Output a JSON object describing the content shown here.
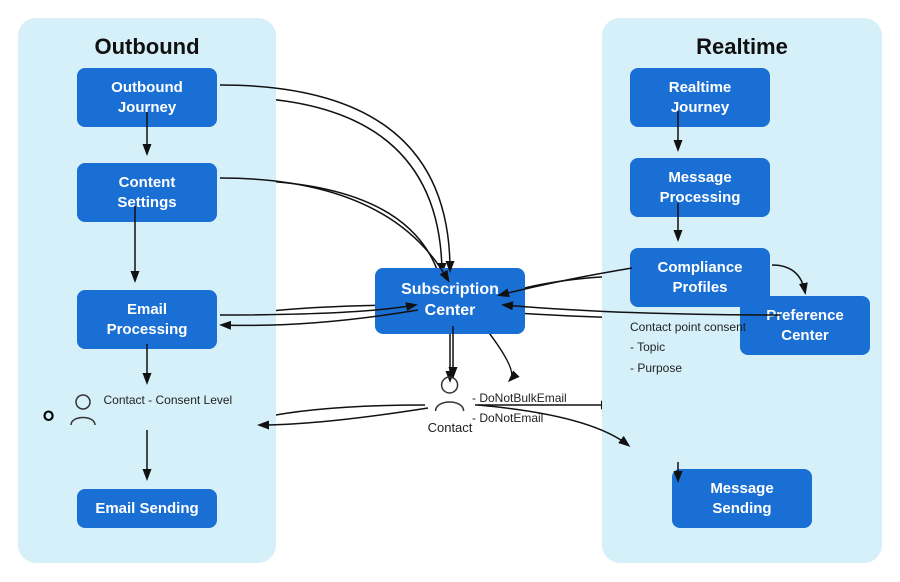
{
  "diagram": {
    "title_outbound": "Outbound",
    "title_realtime": "Realtime",
    "boxes": {
      "outbound_journey": "Outbound Journey",
      "content_settings": "Content Settings",
      "email_processing": "Email Processing",
      "email_sending": "Email Sending",
      "realtime_journey": "Realtime Journey",
      "message_processing": "Message Processing",
      "compliance_profiles": "Compliance Profiles",
      "preference_center": "Preference Center",
      "message_sending": "Message Sending",
      "subscription_center": "Subscription Center"
    },
    "contact_outbound_label": "Contact -  Consent Level",
    "contact_center_label": "Contact",
    "contact_dobulkemail": "- DoNotBulkEmail",
    "contact_donotemail": "- DoNotEmail",
    "contact_point_consent": "Contact point consent",
    "contact_point_topic": "- Topic",
    "contact_point_purpose": "- Purpose"
  }
}
